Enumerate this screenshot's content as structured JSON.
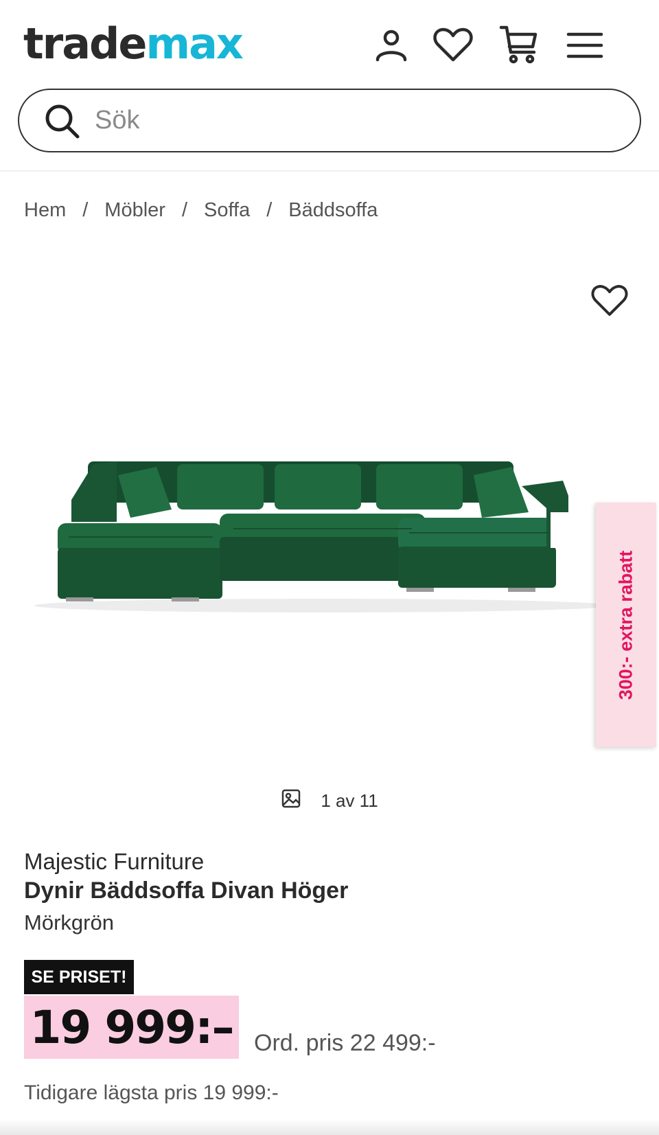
{
  "header": {
    "logo_part1": "trade",
    "logo_part2": "max",
    "icons": [
      "user-icon",
      "heart-icon",
      "cart-icon",
      "menu-icon"
    ]
  },
  "search": {
    "placeholder": "Sök",
    "value": ""
  },
  "breadcrumb": {
    "items": [
      "Hem",
      "Möbler",
      "Soffa",
      "Bäddsoffa"
    ],
    "separator": "/"
  },
  "gallery": {
    "counter_text": "1 av 11"
  },
  "promo_tab": {
    "text": "300:- extra rabatt"
  },
  "product": {
    "brand": "Majestic Furniture",
    "title": "Dynir Bäddsoffa Divan Höger",
    "variant": "Mörkgrön",
    "badge": "SE PRISET!",
    "price": "19 999:–",
    "ordinary_price": "Ord. pris 22 499:-",
    "lowest_price": "Tidigare lägsta pris 19 999:-"
  },
  "colors": {
    "brand_teal": "#17b6d6",
    "price_bg": "#fbcde0",
    "promo_bg": "#fbdde6",
    "promo_text": "#e3155f",
    "sofa_green": "#1c5e3a"
  }
}
